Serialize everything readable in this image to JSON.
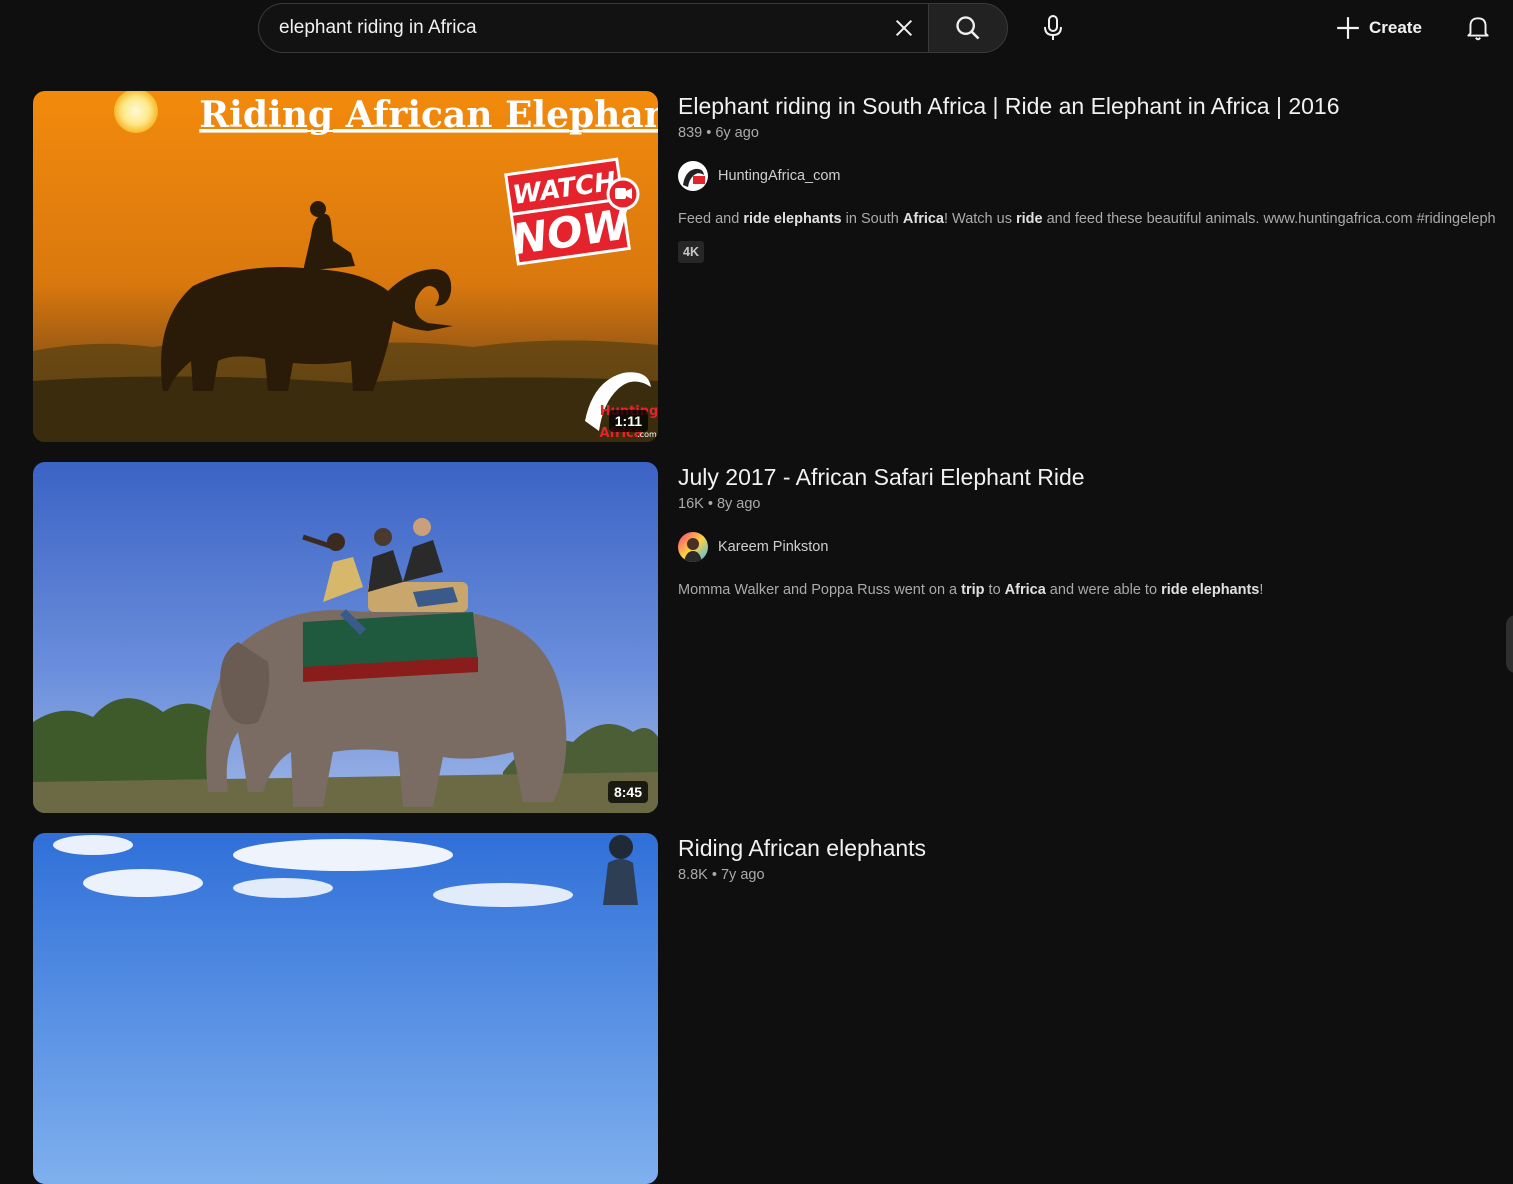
{
  "search": {
    "query": "elephant riding in Africa"
  },
  "header": {
    "create_label": "Create"
  },
  "results": [
    {
      "title": "Elephant riding in South Africa | Ride an Elephant in Africa | 2016",
      "views": "839",
      "age": "6y ago",
      "channel": "HuntingAfrica_com",
      "description_parts": [
        {
          "t": "Feed and ",
          "b": false
        },
        {
          "t": "ride elephants",
          "b": true
        },
        {
          "t": " in South ",
          "b": false
        },
        {
          "t": "Africa",
          "b": true
        },
        {
          "t": "! Watch us ",
          "b": false
        },
        {
          "t": "ride",
          "b": true
        },
        {
          "t": " and feed these beautiful animals. www.huntingafrica.com #ridingeleph",
          "b": false
        }
      ],
      "badge": "4K",
      "duration": "1:11",
      "thumb_text": {
        "headline": "Riding African Elephants",
        "watch": "WATCH",
        "now": "NOW",
        "logo_top": "Hunting",
        "logo_bottom": "Africa",
        "logo_suffix": ".com"
      }
    },
    {
      "title": "July 2017 - African Safari Elephant Ride",
      "views": "16K",
      "age": "8y ago",
      "channel": "Kareem Pinkston",
      "description_parts": [
        {
          "t": "Momma Walker and Poppa Russ went on a ",
          "b": false
        },
        {
          "t": "trip",
          "b": true
        },
        {
          "t": " to ",
          "b": false
        },
        {
          "t": "Africa",
          "b": true
        },
        {
          "t": " and were able to ",
          "b": false
        },
        {
          "t": "ride elephants",
          "b": true
        },
        {
          "t": "!",
          "b": false
        }
      ],
      "duration": "8:45"
    },
    {
      "title": "Riding African elephants",
      "views": "8.8K",
      "age": "7y ago"
    }
  ],
  "colors": {
    "background": "#0f0f0f",
    "text": "#f1f1f1",
    "secondary_text": "#aaaaaa",
    "accent_red": "#e4232c"
  },
  "icons": [
    "close-icon",
    "search-icon",
    "mic-icon",
    "plus-icon",
    "bell-icon"
  ]
}
